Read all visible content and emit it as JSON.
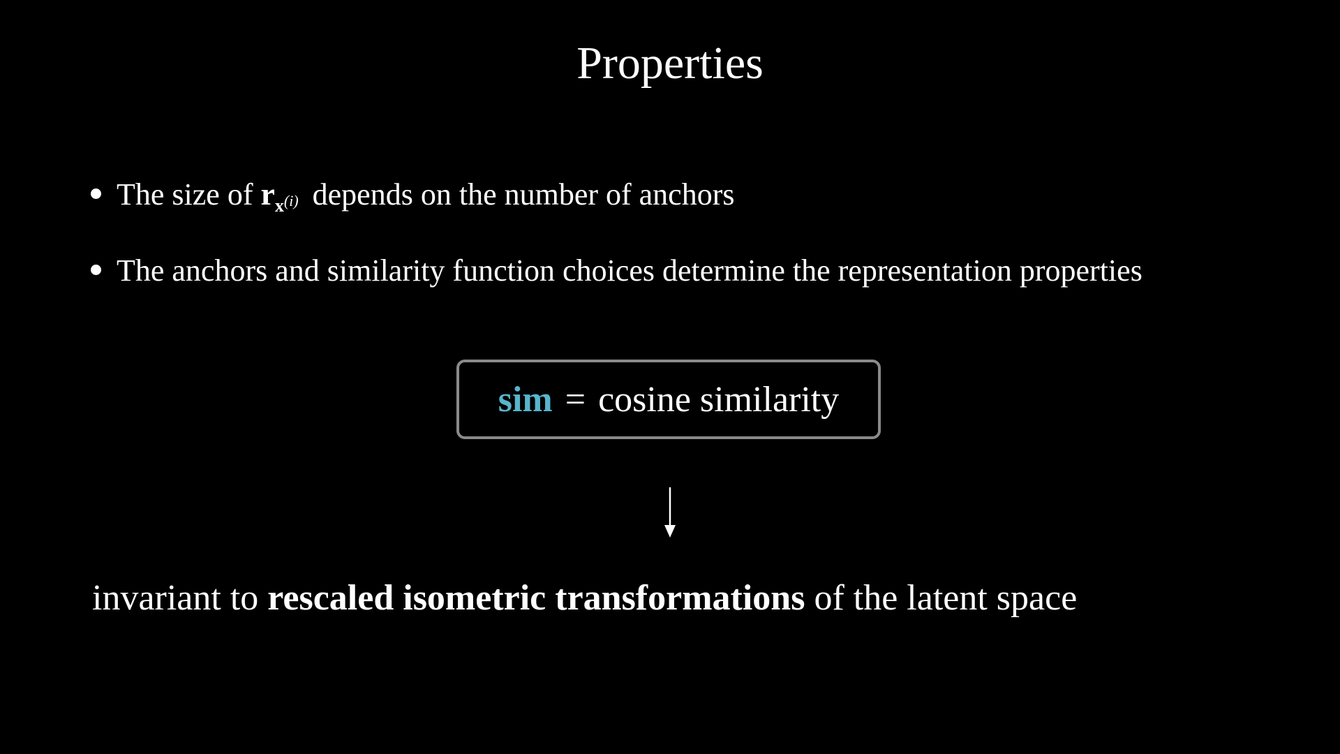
{
  "title": "Properties",
  "bullets": [
    {
      "before": "The size of",
      "math_main": "r",
      "math_sub_bold": "x",
      "math_sup": "(i)",
      "after": "depends on the number of anchors"
    },
    {
      "text": "The anchors and similarity function choices determine the representation properties"
    }
  ],
  "formula": {
    "sim": "sim",
    "equals": "=",
    "rhs": "cosine similarity"
  },
  "conclusion": {
    "before": "invariant to",
    "emphasis": "rescaled isometric transformations",
    "after": "of the latent space"
  },
  "colors": {
    "background": "#000000",
    "text": "#ffffff",
    "sim_accent": "#58b4cc",
    "box_border": "#8a8a8a"
  },
  "icons": {
    "arrow": "arrow-down-icon",
    "bullet": "bullet-dot-icon"
  }
}
